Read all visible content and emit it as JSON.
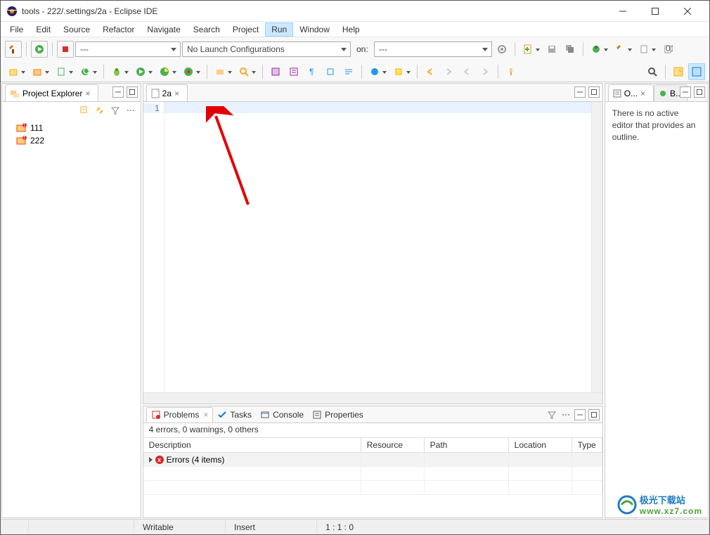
{
  "window": {
    "title": "tools - 222/.settings/2a - Eclipse IDE"
  },
  "menu": {
    "items": [
      "File",
      "Edit",
      "Source",
      "Refactor",
      "Navigate",
      "Search",
      "Project",
      "Run",
      "Window",
      "Help"
    ],
    "active_index": 7
  },
  "toolbar1": {
    "combo1": "---",
    "combo2": "No Launch Configurations",
    "on_label": "on:",
    "combo3": "---"
  },
  "explorer": {
    "title": "Project Explorer",
    "projects": [
      {
        "name": "111"
      },
      {
        "name": "222"
      }
    ]
  },
  "editor": {
    "tab": "2a",
    "line_numbers": [
      "1"
    ]
  },
  "outline": {
    "tab1": "O...",
    "tab2": "B...",
    "message": "There is no active editor that provides an outline."
  },
  "bottom": {
    "tabs": [
      "Problems",
      "Tasks",
      "Console",
      "Properties"
    ],
    "summary": "4 errors, 0 warnings, 0 others",
    "columns": [
      "Description",
      "Resource",
      "Path",
      "Location",
      "Type"
    ],
    "error_row": "Errors (4 items)"
  },
  "status": {
    "writable": "Writable",
    "insert": "Insert",
    "pos": "1 : 1 : 0"
  },
  "watermark": {
    "line1": "极光下载站",
    "line2": "www.xz7.com"
  }
}
